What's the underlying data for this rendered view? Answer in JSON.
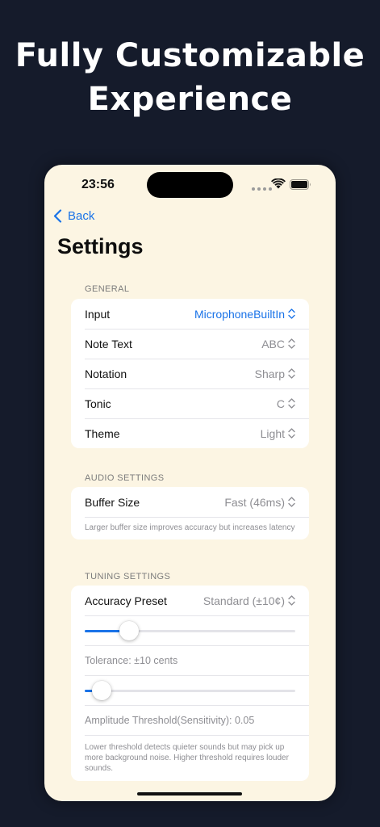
{
  "headline": {
    "line1": "Fully Customizable",
    "line2": "Experience"
  },
  "status_bar": {
    "time": "23:56",
    "icons": [
      "signal-dots-icon",
      "wifi-icon",
      "battery-icon"
    ]
  },
  "nav": {
    "back_label": "Back",
    "title": "Settings"
  },
  "colors": {
    "background": "#151b2b",
    "screen": "#fcf5e3",
    "accent": "#1a73e8",
    "secondary_text": "#8e8e93"
  },
  "general": {
    "header": "GENERAL",
    "rows": [
      {
        "label": "Input",
        "value": "MicrophoneBuiltIn"
      },
      {
        "label": "Note Text",
        "value": "ABC"
      },
      {
        "label": "Notation",
        "value": "Sharp"
      },
      {
        "label": "Tonic",
        "value": "C"
      },
      {
        "label": "Theme",
        "value": "Light"
      }
    ]
  },
  "audio": {
    "header": "AUDIO SETTINGS",
    "buffer_label": "Buffer Size",
    "buffer_value": "Fast (46ms)",
    "note": "Larger buffer size improves accuracy but increases latency"
  },
  "tuning": {
    "header": "TUNING SETTINGS",
    "preset_label": "Accuracy Preset",
    "preset_value": "Standard (±10¢)",
    "tolerance_slider": {
      "fraction": 0.21
    },
    "tolerance_text": "Tolerance: ±10 cents",
    "amplitude_slider": {
      "fraction": 0.08
    },
    "amplitude_text": "Amplitude Threshold(Sensitivity): 0.05",
    "note": "Lower threshold detects quieter sounds but may pick up more background noise. Higher threshold requires louder sounds."
  }
}
